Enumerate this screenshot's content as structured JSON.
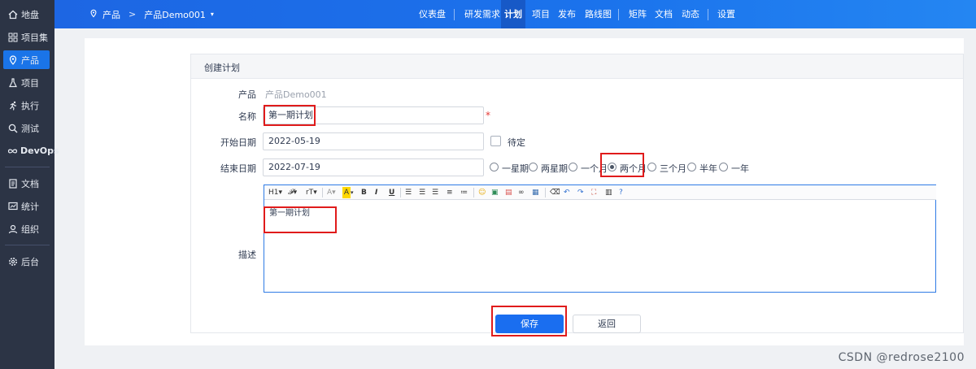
{
  "sidebar": {
    "items": [
      {
        "label": "地盘",
        "icon": "home-icon"
      },
      {
        "label": "项目集",
        "icon": "grid-icon"
      },
      {
        "label": "产品",
        "icon": "location-pin-icon"
      },
      {
        "label": "项目",
        "icon": "flask-icon"
      },
      {
        "label": "执行",
        "icon": "run-icon"
      },
      {
        "label": "测试",
        "icon": "search-icon"
      },
      {
        "label": "DevOps",
        "icon": "infinity-icon"
      },
      {
        "label": "文档",
        "icon": "document-icon"
      },
      {
        "label": "统计",
        "icon": "chart-icon"
      },
      {
        "label": "组织",
        "icon": "user-icon"
      },
      {
        "label": "后台",
        "icon": "gear-icon"
      }
    ],
    "active_index": 2
  },
  "topbar": {
    "breadcrumb": {
      "root": "产品",
      "separator": ">",
      "current": "产品Demo001"
    },
    "nav": [
      "仪表盘",
      "研发需求",
      "计划",
      "项目",
      "发布",
      "路线图",
      "矩阵",
      "文档",
      "动态",
      "设置"
    ],
    "active": "计划"
  },
  "form": {
    "title": "创建计划",
    "product_label": "产品",
    "product_value": "产品Demo001",
    "name_label": "名称",
    "name_value": "第一期计划",
    "required_mark": "*",
    "start_label": "开始日期",
    "start_value": "2022-05-19",
    "pending_label": "待定",
    "end_label": "结束日期",
    "end_value": "2022-07-19",
    "duration_options": [
      "一星期",
      "两星期",
      "一个月",
      "两个月",
      "三个月",
      "半年",
      "一年"
    ],
    "duration_selected": "两个月",
    "desc_label": "描述",
    "desc_value": "第一期计划",
    "save_label": "保存",
    "back_label": "返回"
  },
  "editor_toolbar": [
    "H1",
    "F",
    "rT",
    "A",
    "A",
    "B",
    "I",
    "U",
    "align-left",
    "align-center",
    "align-right",
    "ordered-list",
    "unordered-list",
    "emoji",
    "image",
    "code",
    "link",
    "table",
    "eraser",
    "undo",
    "redo",
    "fullscreen",
    "source",
    "help"
  ],
  "watermark": "CSDN @redrose2100",
  "colors": {
    "primary": "#1a6ef0",
    "sidebar": "#2c3445",
    "highlight": "#e01b1b"
  }
}
